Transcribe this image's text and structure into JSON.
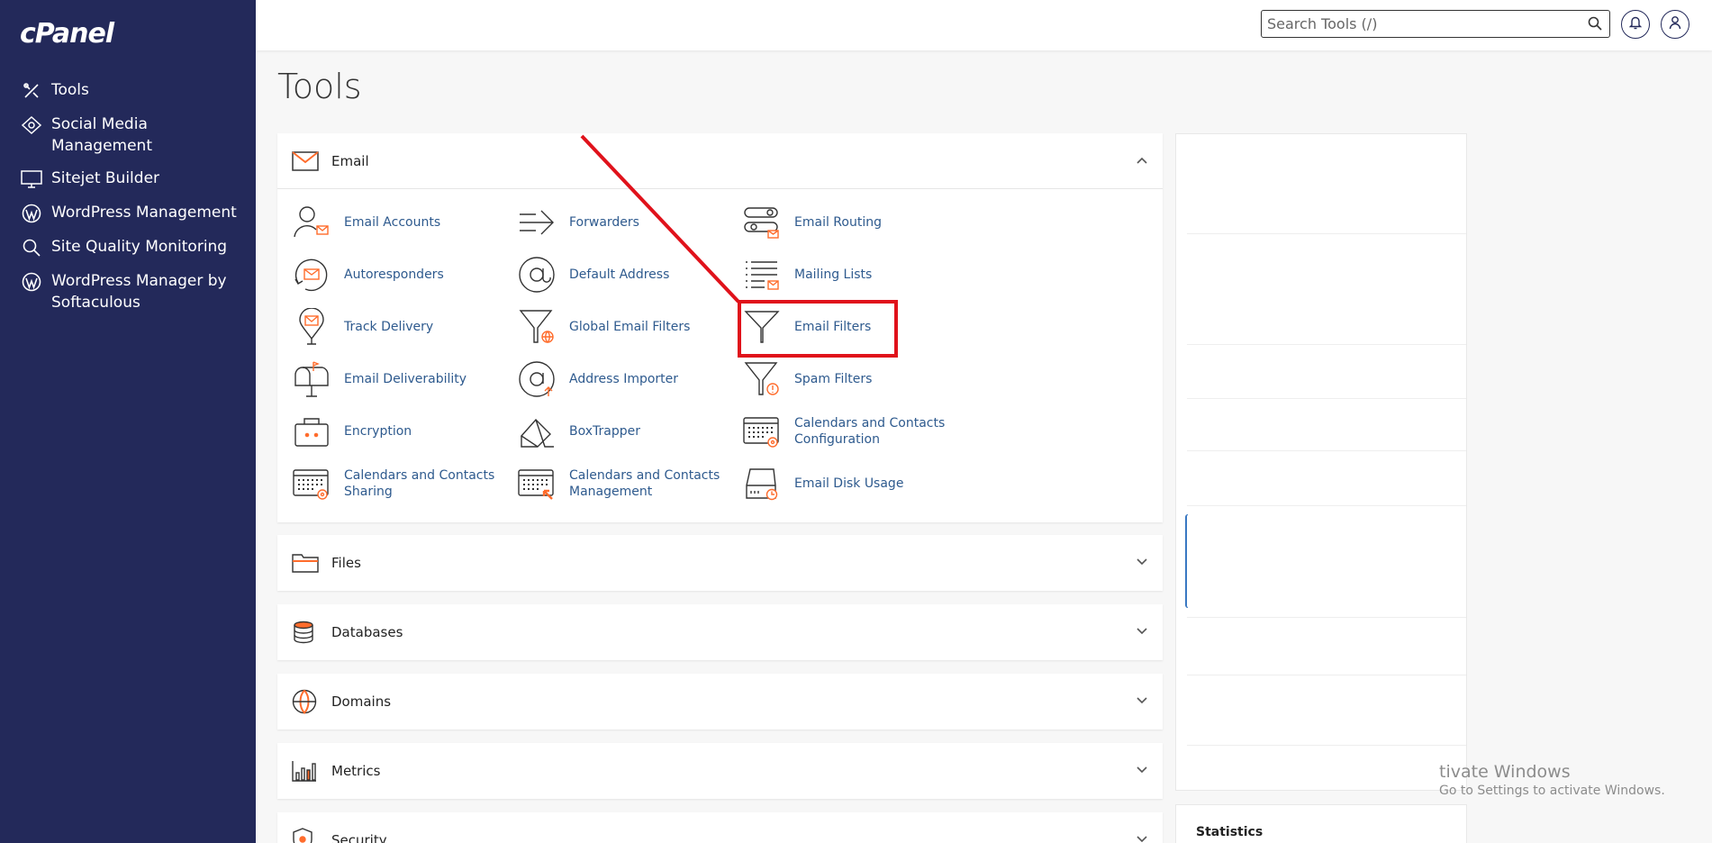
{
  "brand": {
    "logo_text": "cPanel"
  },
  "sidebar": {
    "items": [
      {
        "label": "Tools",
        "icon": "tools-icon"
      },
      {
        "label": "Social Media Management",
        "icon": "social-media-icon"
      },
      {
        "label": "Sitejet Builder",
        "icon": "sitejet-icon"
      },
      {
        "label": "WordPress Management",
        "icon": "wordpress-icon"
      },
      {
        "label": "Site Quality Monitoring",
        "icon": "magnifier-icon"
      },
      {
        "label": "WordPress Manager by Softaculous",
        "icon": "wordpress-icon"
      }
    ]
  },
  "header": {
    "search_placeholder": "Search Tools (/)"
  },
  "page": {
    "title": "Tools"
  },
  "email_section": {
    "title": "Email",
    "tools": [
      {
        "label": "Email Accounts",
        "icon": "email-accounts-icon"
      },
      {
        "label": "Forwarders",
        "icon": "forwarders-icon"
      },
      {
        "label": "Email Routing",
        "icon": "email-routing-icon"
      },
      {
        "label": "Autoresponders",
        "icon": "autoresponders-icon"
      },
      {
        "label": "Default Address",
        "icon": "at-sign-icon"
      },
      {
        "label": "Mailing Lists",
        "icon": "mailing-lists-icon"
      },
      {
        "label": "Track Delivery",
        "icon": "track-delivery-icon"
      },
      {
        "label": "Global Email Filters",
        "icon": "global-filter-icon"
      },
      {
        "label": "Email Filters",
        "icon": "funnel-icon"
      },
      {
        "label": "Email Deliverability",
        "icon": "mailbox-icon"
      },
      {
        "label": "Address Importer",
        "icon": "address-importer-icon"
      },
      {
        "label": "Spam Filters",
        "icon": "spam-filter-icon"
      },
      {
        "label": "Encryption",
        "icon": "encryption-icon"
      },
      {
        "label": "BoxTrapper",
        "icon": "boxtrapper-icon"
      },
      {
        "label": "Calendars and Contacts Configuration",
        "icon": "calendar-config-icon"
      },
      {
        "label": "Calendars and Contacts Sharing",
        "icon": "calendar-sharing-icon"
      },
      {
        "label": "Calendars and Contacts Management",
        "icon": "calendar-management-icon"
      },
      {
        "label": "Email Disk Usage",
        "icon": "disk-usage-icon"
      }
    ]
  },
  "sections": [
    {
      "title": "Files",
      "icon": "folder-icon"
    },
    {
      "title": "Databases",
      "icon": "database-icon"
    },
    {
      "title": "Domains",
      "icon": "globe-icon"
    },
    {
      "title": "Metrics",
      "icon": "bar-chart-icon"
    },
    {
      "title": "Security",
      "icon": "shield-icon"
    }
  ],
  "right_panel": {
    "statistics_title": "Statistics"
  },
  "watermark": {
    "line1": "tivate Windows",
    "line2": "Go to Settings to activate Windows."
  },
  "colors": {
    "sidebar_bg": "#23295a",
    "link": "#2e5a8e",
    "accent_orange": "#ff6c2c",
    "annotation_red": "#e0121b"
  }
}
